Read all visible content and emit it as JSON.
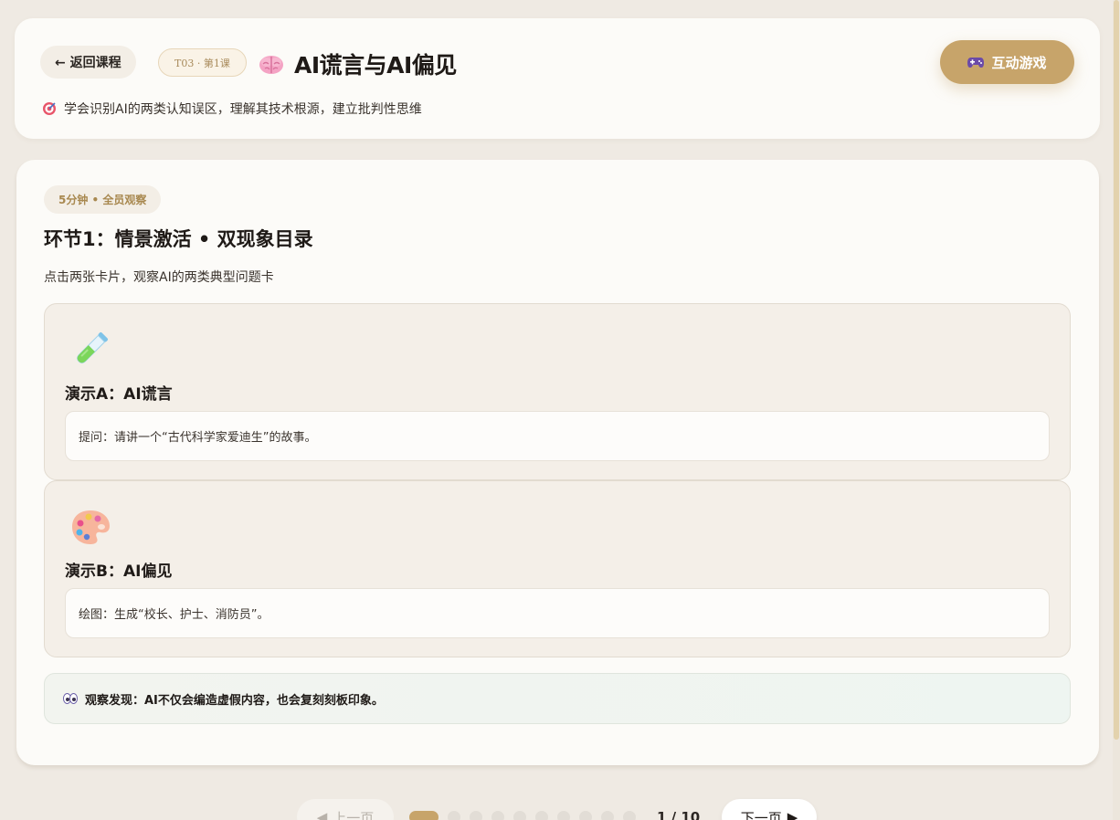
{
  "header": {
    "back_label": "← 返回课程",
    "lesson_tag": "T03 · 第1课",
    "title": "AI谎言与AI偏见",
    "subtitle": "学会识别AI的两类认知误区，理解其技术根源，建立批判性思维",
    "game_button_label": "互动游戏"
  },
  "section": {
    "badge": "5分钟 • 全员观察",
    "title": "环节1：情景激活 • 双现象目录",
    "description": "点击两张卡片，观察AI的两类典型问题卡",
    "demos": [
      {
        "icon": "test-tube-icon",
        "title": "演示A：AI谎言",
        "prompt": "提问：请讲一个“古代科学家爱迪生”的故事。"
      },
      {
        "icon": "palette-icon",
        "title": "演示B：AI偏见",
        "prompt": "绘图：生成“校长、护士、消防员”。"
      }
    ],
    "observation": "观察发现：AI不仅会编造虚假内容，也会复刻刻板印象。"
  },
  "pagination": {
    "prev_label": "上一页",
    "next_label": "下一页",
    "current": 1,
    "total": 10,
    "indicator": "1 / 10"
  },
  "colors": {
    "accent": "#c7a46a",
    "background": "#efeae3",
    "card": "#fcfbf8",
    "demo_card": "#f4efe8"
  }
}
